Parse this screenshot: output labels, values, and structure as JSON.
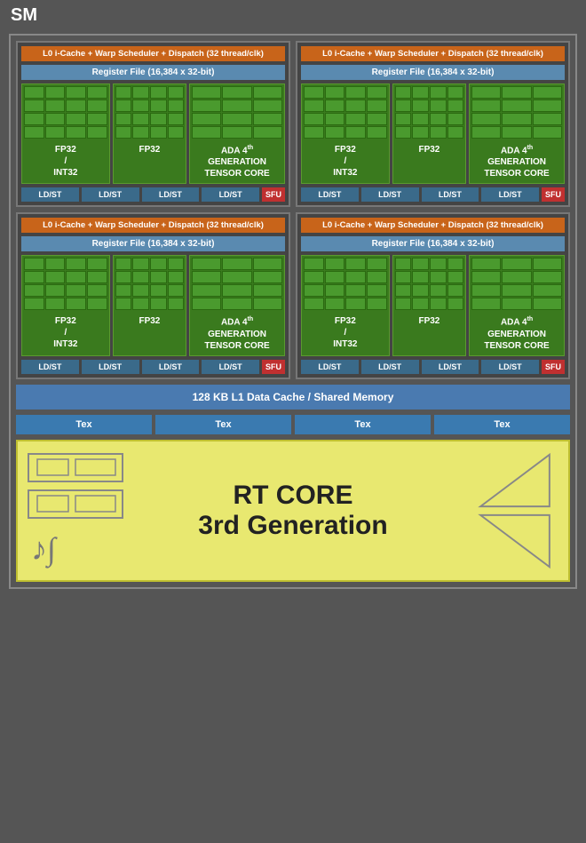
{
  "title": "SM",
  "quadrants": [
    {
      "id": "q1",
      "warp_label": "L0 i-Cache + Warp Scheduler + Dispatch (32 thread/clk)",
      "register_label": "Register File (16,384 x 32-bit)",
      "fp32_int32_label": "FP32\n/\nINT32",
      "fp32_label": "FP32",
      "tensor_label": "ADA 4th GENERATION TENSOR CORE",
      "ldst_labels": [
        "LD/ST",
        "LD/ST",
        "LD/ST",
        "LD/ST"
      ],
      "sfu_label": "SFU"
    },
    {
      "id": "q2",
      "warp_label": "L0 i-Cache + Warp Scheduler + Dispatch (32 thread/clk)",
      "register_label": "Register File (16,384 x 32-bit)",
      "fp32_int32_label": "FP32\n/\nINT32",
      "fp32_label": "FP32",
      "tensor_label": "ADA 4th GENERATION TENSOR CORE",
      "ldst_labels": [
        "LD/ST",
        "LD/ST",
        "LD/ST",
        "LD/ST"
      ],
      "sfu_label": "SFU"
    },
    {
      "id": "q3",
      "warp_label": "L0 i-Cache + Warp Scheduler + Dispatch (32 thread/clk)",
      "register_label": "Register File (16,384 x 32-bit)",
      "fp32_int32_label": "FP32\n/\nINT32",
      "fp32_label": "FP32",
      "tensor_label": "ADA 4th GENERATION TENSOR CORE",
      "ldst_labels": [
        "LD/ST",
        "LD/ST",
        "LD/ST",
        "LD/ST"
      ],
      "sfu_label": "SFU"
    },
    {
      "id": "q4",
      "warp_label": "L0 i-Cache + Warp Scheduler + Dispatch (32 thread/clk)",
      "register_label": "Register File (16,384 x 32-bit)",
      "fp32_int32_label": "FP32\n/\nINT32",
      "fp32_label": "FP32",
      "tensor_label": "ADA 4th GENERATION TENSOR CORE",
      "ldst_labels": [
        "LD/ST",
        "LD/ST",
        "LD/ST",
        "LD/ST"
      ],
      "sfu_label": "SFU"
    }
  ],
  "l1_cache_label": "128 KB L1 Data Cache / Shared Memory",
  "tex_labels": [
    "Tex",
    "Tex",
    "Tex",
    "Tex"
  ],
  "rt_core_line1": "RT CORE",
  "rt_core_line2": "3rd Generation"
}
